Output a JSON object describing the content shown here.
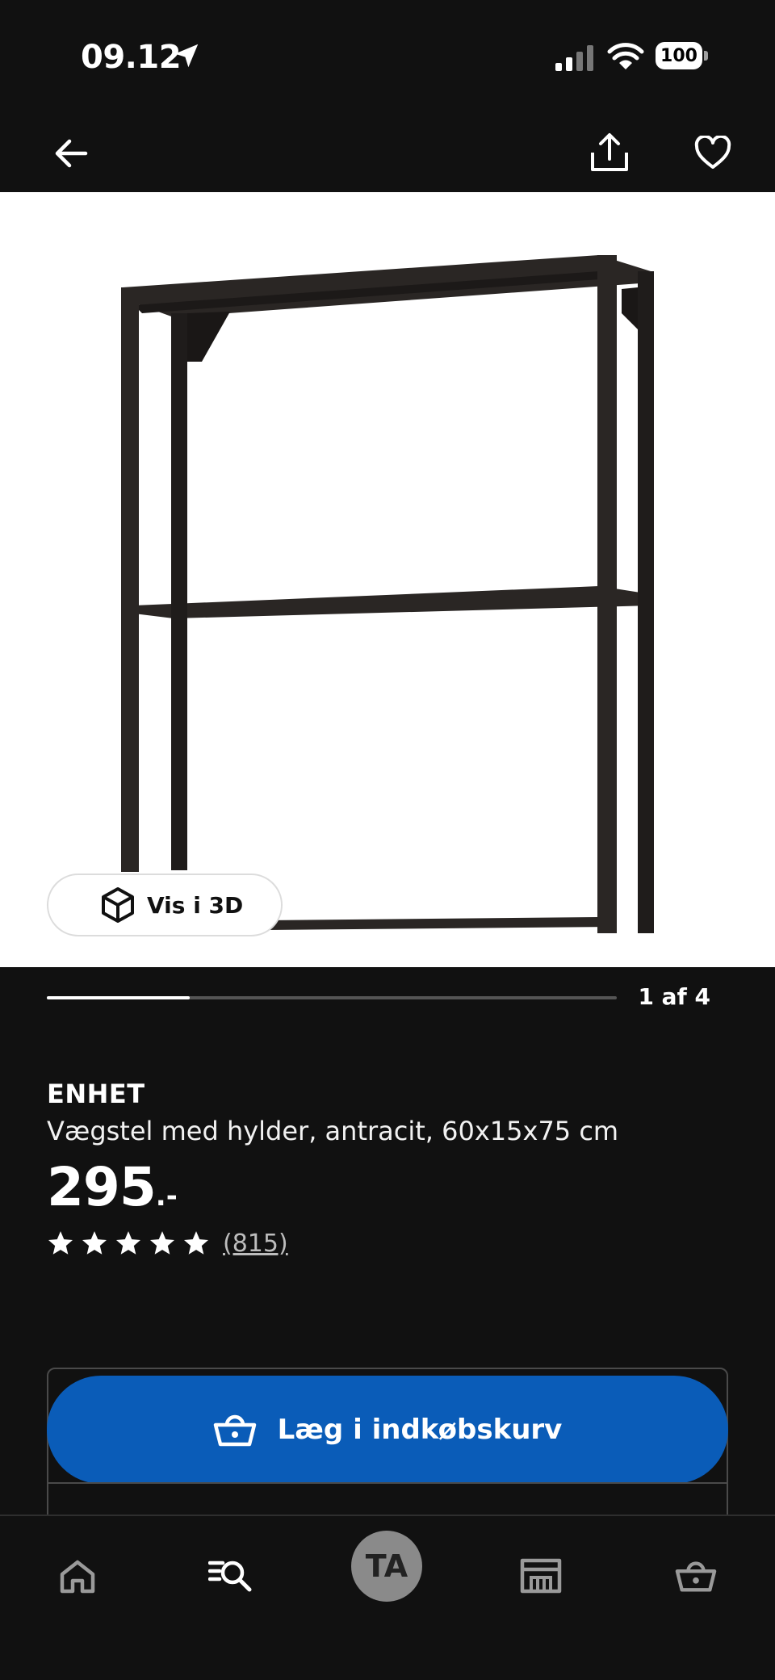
{
  "status_bar": {
    "time": "09.12",
    "battery": "100"
  },
  "nav": {
    "back": "arrow-left-icon",
    "share": "share-icon",
    "favorite": "heart-icon"
  },
  "gallery": {
    "vis3d_label": "Vis i 3D",
    "counter": "1 af 4",
    "progress": 0.25
  },
  "product": {
    "brand": "ENHET",
    "description": "Vægstel med hylder, antracit, 60x15x75 cm",
    "price_int": "295",
    "price_suffix": ".-",
    "stars": 5,
    "review_count": "(815)"
  },
  "cta": {
    "add_to_cart": "Læg i indkøbskurv"
  },
  "tabbar": {
    "avatar_initials": "TA",
    "items": [
      "home-icon",
      "search-list-icon",
      "profile-avatar",
      "store-icon",
      "basket-icon"
    ]
  },
  "colors": {
    "background": "#111111",
    "accent_blue": "#0a5cb8",
    "white": "#ffffff"
  }
}
